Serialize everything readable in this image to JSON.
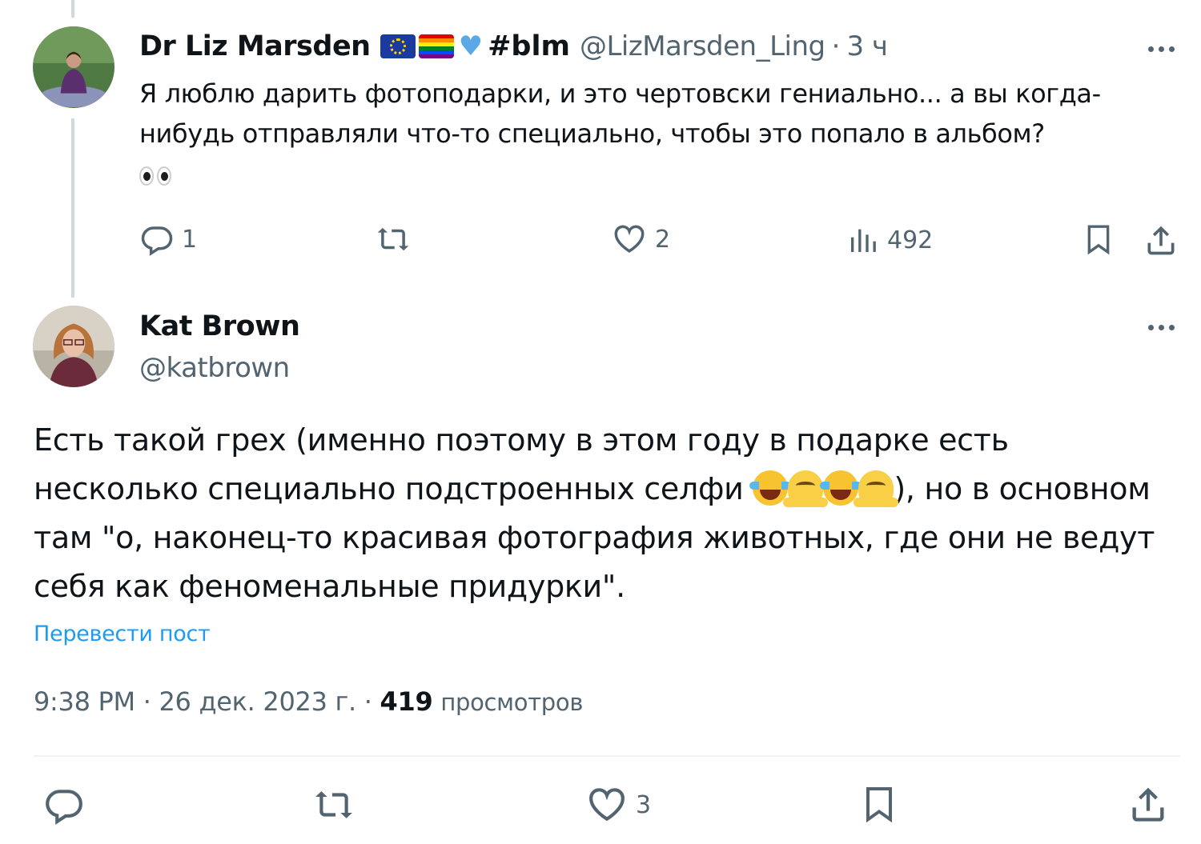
{
  "tweet1": {
    "author_name": "Dr Liz Marsden",
    "hashtag": "#blm",
    "handle": "@LizMarsden_Ling",
    "separator": "·",
    "time": "3 ч",
    "text": "Я люблю дарить фотоподарки, и это чертовски гениально... а вы когда-нибудь отправляли что-то специально, чтобы это попало в альбом?",
    "actions": {
      "replies": "1",
      "likes": "2",
      "views": "492"
    }
  },
  "tweet2": {
    "author_name": "Kat Brown",
    "handle": "@katbrown",
    "text_part1": "Есть такой грех (именно поэтому в этом году в подарке есть несколько специально подстроенных селфи ",
    "text_part2": "), но в основном там \"о, наконец-то красивая фотография животных, где они не ведут себя как феноменальные придурки\".",
    "translate_label": "Перевести пост",
    "timestamp": "9:38 PM · 26 дек. 2023 г. · ",
    "views_count": "419",
    "views_label": "просмотров",
    "actions": {
      "likes": "3"
    }
  },
  "icons": {
    "reply": "reply-icon",
    "retweet": "retweet-icon",
    "like": "heart-icon",
    "views": "views-icon",
    "bookmark": "bookmark-icon",
    "share": "share-icon",
    "more": "more-icon"
  },
  "colors": {
    "text": "#0f1419",
    "secondary": "#536471",
    "link": "#1d9bf0",
    "thread_line": "#cfd9de"
  }
}
